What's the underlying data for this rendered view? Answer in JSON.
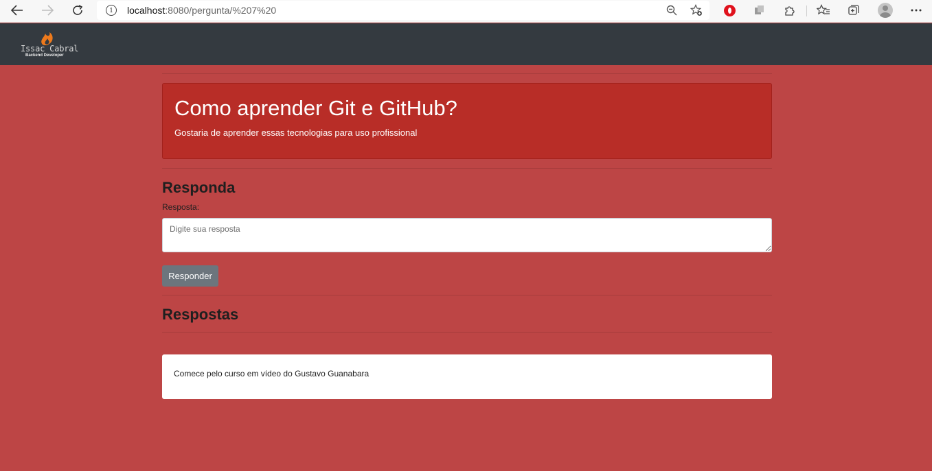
{
  "browser": {
    "url_host": "localhost",
    "url_path": ":8080/pergunta/%207%20"
  },
  "navbar": {
    "logo_name": "Issac Cabral",
    "logo_subtitle": "Backend Developer"
  },
  "question": {
    "title": "Como aprender Git e GitHub?",
    "description": "Gostaria de aprender essas tecnologias para uso profissional"
  },
  "reply_form": {
    "heading": "Responda",
    "label": "Resposta:",
    "placeholder": "Digite sua resposta",
    "button_label": "Responder"
  },
  "answers": {
    "heading": "Respostas",
    "items": [
      {
        "text": "Comece pelo curso em vídeo do Gustavo Guanabara"
      }
    ]
  },
  "colors": {
    "page_background": "#bd4545",
    "navbar": "#343a40",
    "question_card": "#b82d27",
    "button": "#6c757d"
  }
}
